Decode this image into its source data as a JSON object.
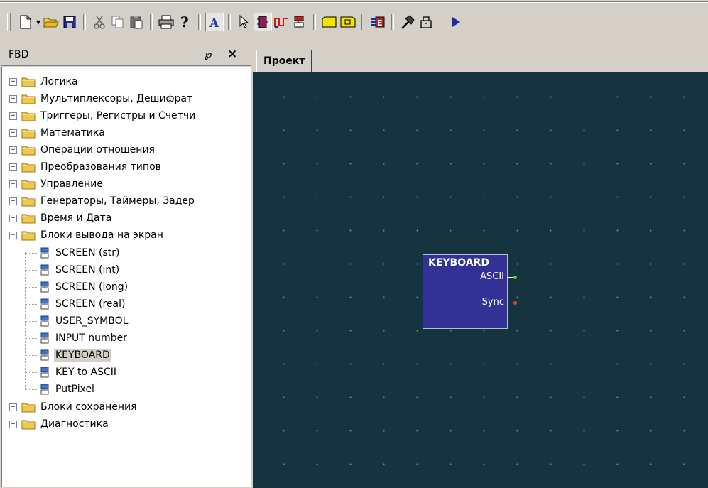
{
  "toolbar": {
    "icons": [
      "new-icon",
      "dropdown-arrow-icon",
      "open-icon",
      "save-icon",
      "cut-icon",
      "copy-icon",
      "paste-icon",
      "print-icon",
      "help-icon",
      "text-tool-icon",
      "pointer-icon",
      "block-tool-icon",
      "wire-tool-icon",
      "connect-tool-icon",
      "input-block-icon",
      "output-block-icon",
      "module-icon",
      "build-icon",
      "compile-icon",
      "run-icon"
    ]
  },
  "panel": {
    "title": "FBD",
    "pin_glyph": "℘",
    "close_glyph": "×"
  },
  "tree": {
    "categories": [
      {
        "label": "Логика",
        "expanded": false
      },
      {
        "label": "Мультиплексоры, Дешифрат",
        "expanded": false
      },
      {
        "label": "Триггеры, Регистры и Счетчи",
        "expanded": false
      },
      {
        "label": "Математика",
        "expanded": false
      },
      {
        "label": "Операции отношения",
        "expanded": false
      },
      {
        "label": "Преобразования типов",
        "expanded": false
      },
      {
        "label": "Управление",
        "expanded": false
      },
      {
        "label": "Генераторы, Таймеры, Задер",
        "expanded": false
      },
      {
        "label": "Время и Дата",
        "expanded": false
      },
      {
        "label": "Блоки вывода на экран",
        "expanded": true
      },
      {
        "label": "Блоки сохранения",
        "expanded": false
      },
      {
        "label": "Диагностика",
        "expanded": false
      }
    ],
    "children": [
      {
        "label": "SCREEN (str)",
        "selected": false
      },
      {
        "label": "SCREEN (int)",
        "selected": false
      },
      {
        "label": "SCREEN (long)",
        "selected": false
      },
      {
        "label": "SCREEN (real)",
        "selected": false
      },
      {
        "label": "USER_SYMBOL",
        "selected": false
      },
      {
        "label": "INPUT number",
        "selected": false
      },
      {
        "label": "KEYBOARD",
        "selected": true
      },
      {
        "label": "KEY to ASCII",
        "selected": false
      },
      {
        "label": "PutPixel",
        "selected": false
      }
    ],
    "plus": "+",
    "minus": "−"
  },
  "tabs": [
    {
      "label": "Проект",
      "active": true
    }
  ],
  "block": {
    "name": "KEYBOARD",
    "outputs": [
      {
        "label": "ASCII",
        "color": "#3fd24a"
      },
      {
        "label": "Sync",
        "color": "#e8403c"
      }
    ]
  },
  "colors": {
    "canvas": "#16343f",
    "block": "#323296",
    "folder": "#f0c850"
  }
}
